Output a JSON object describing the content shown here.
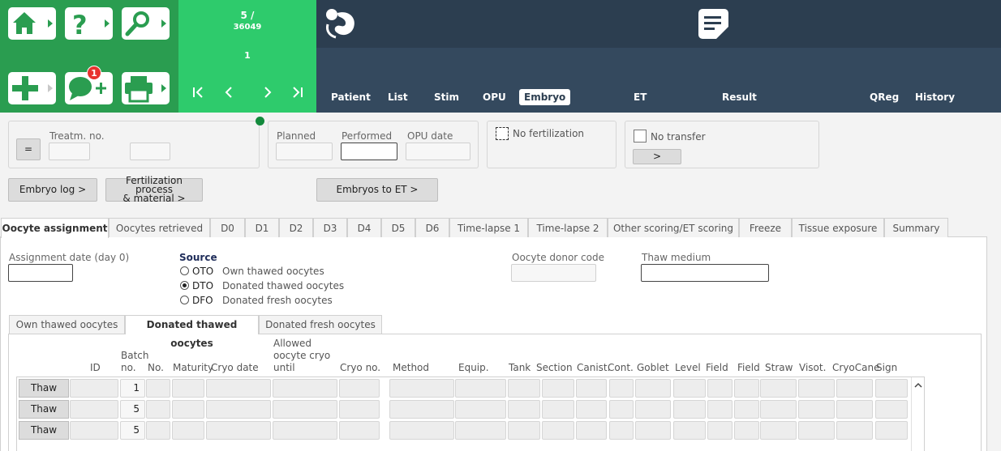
{
  "counter": {
    "line1": "5 /",
    "line2": "36049",
    "line3": "1"
  },
  "notifications": {
    "count": "1"
  },
  "top_tabs": [
    "Patient",
    "List",
    "Stim",
    "OPU",
    "Embryo",
    "ET",
    "Result",
    "QReg",
    "History"
  ],
  "active_top_tab": "Embryo",
  "header": {
    "eq_button": "=",
    "treatment_no_label": "Treatm. no.",
    "planned_label": "Planned",
    "performed_label": "Performed",
    "opu_date_label": "OPU date",
    "no_fertilization_label": "No fertilization",
    "no_transfer_label": "No transfer",
    "arrow_button": ">",
    "embryo_log_button": "Embryo log >",
    "fertilization_button_line1": "Fertilization process",
    "fertilization_button_line2": "& material >",
    "embryos_to_et_button": "Embryos to ET >"
  },
  "tabs": [
    "Oocyte assignment",
    "Oocytes retrieved",
    "D0",
    "D1",
    "D2",
    "D3",
    "D4",
    "D5",
    "D6",
    "Time-lapse 1",
    "Time-lapse 2",
    "Other scoring/ET scoring",
    "Freeze",
    "Tissue exposure",
    "Summary"
  ],
  "active_tab": "Oocyte assignment",
  "assignment": {
    "date_label": "Assignment date (day 0)",
    "source_label": "Source",
    "sources": [
      {
        "code": "OTO",
        "desc": "Own thawed oocytes",
        "selected": false
      },
      {
        "code": "DTO",
        "desc": "Donated thawed oocytes",
        "selected": true
      },
      {
        "code": "DFO",
        "desc": "Donated fresh oocytes",
        "selected": false
      }
    ],
    "donor_code_label": "Oocyte donor code",
    "thaw_medium_label": "Thaw medium"
  },
  "sub_tabs": [
    "Own thawed oocytes",
    "Donated thawed oocytes",
    "Donated fresh oocytes"
  ],
  "active_sub_tab": "Donated thawed oocytes",
  "table": {
    "headers": {
      "id": "ID",
      "batch_line1": "Batch",
      "batch_line2": "no.",
      "no": "No.",
      "maturity": "Maturity",
      "cryo_date": "Cryo date",
      "allowed_line1": "Allowed",
      "allowed_line2": "oocyte cryo",
      "allowed_line3": "until",
      "cryo_no": "Cryo no.",
      "method": "Method",
      "equip": "Equip.",
      "tank": "Tank",
      "section": "Section",
      "canist": "Canist.",
      "cont": "Cont.",
      "goblet": "Goblet",
      "level": "Level",
      "field1": "Field",
      "field2": "Field",
      "straw": "Straw",
      "visot": "Visot.",
      "cryocane": "CryoCane",
      "sign": "Sign"
    },
    "thaw_label": "Thaw",
    "rows": [
      {
        "batch": "1"
      },
      {
        "batch": "5"
      },
      {
        "batch": "5"
      }
    ]
  }
}
